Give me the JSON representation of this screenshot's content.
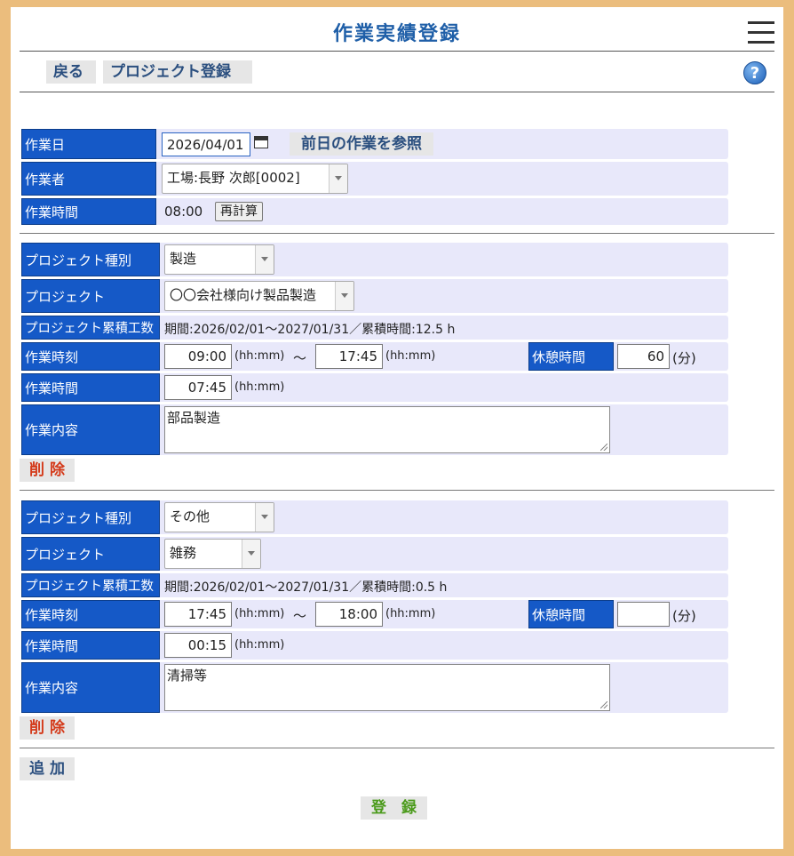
{
  "header": {
    "title": "作業実績登録",
    "menu_icon": "hamburger-icon",
    "help_icon": "help-icon",
    "help_glyph": "?"
  },
  "toolbar": {
    "back_label": "戻る",
    "project_register_label": "プロジェクト登録"
  },
  "work_info": {
    "date_label": "作業日",
    "date_value": "2026/04/01",
    "calendar_icon": "calendar-icon",
    "prev_day_label": "前日の作業を参照",
    "worker_label": "作業者",
    "worker_value": "工場:長野 次郎[0002]",
    "time_label": "作業時間",
    "time_value": "08:00",
    "recalc_label": "再計算"
  },
  "entries": [
    {
      "type_label": "プロジェクト種別",
      "type_value": "製造",
      "project_label": "プロジェクト",
      "project_value": "〇〇会社様向け製品製造",
      "cumulative_label": "プロジェクト累積工数",
      "cumulative_value": "期間:2026/02/01～2027/01/31／累積時間:12.5 h",
      "clock_label": "作業時刻",
      "start_value": "09:00",
      "hhmm1": "(hh:mm)",
      "tilde": "～",
      "end_value": "17:45",
      "hhmm2": "(hh:mm)",
      "break_label": "休憩時間",
      "break_value": "60",
      "break_unit": "(分)",
      "duration_label": "作業時間",
      "duration_value": "07:45",
      "hhmm3": "(hh:mm)",
      "content_label": "作業内容",
      "content_value": "部品製造",
      "delete_label": "削 除"
    },
    {
      "type_label": "プロジェクト種別",
      "type_value": "その他",
      "project_label": "プロジェクト",
      "project_value": "雑務",
      "cumulative_label": "プロジェクト累積工数",
      "cumulative_value": "期間:2026/02/01～2027/01/31／累積時間:0.5 h",
      "clock_label": "作業時刻",
      "start_value": "17:45",
      "hhmm1": "(hh:mm)",
      "tilde": "～",
      "end_value": "18:00",
      "hhmm2": "(hh:mm)",
      "break_label": "休憩時間",
      "break_value": "",
      "break_unit": "(分)",
      "duration_label": "作業時間",
      "duration_value": "00:15",
      "hhmm3": "(hh:mm)",
      "content_label": "作業内容",
      "content_value": "清掃等",
      "delete_label": "削 除"
    }
  ],
  "footer": {
    "add_label": "追 加",
    "register_label": "登　録"
  },
  "colors": {
    "label_bg": "#1559c7",
    "row_bg": "#e8e8fa",
    "delete": "#d43a1a",
    "register": "#4a9a1a",
    "title": "#1f5fa8",
    "frame": "#ebbd7d"
  }
}
